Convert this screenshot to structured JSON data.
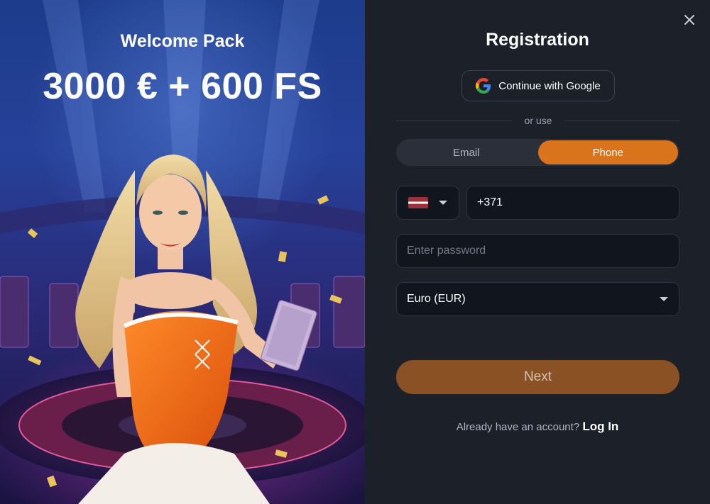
{
  "promo": {
    "title": "Welcome Pack",
    "amount": "3000 € + 600 FS"
  },
  "form": {
    "title": "Registration",
    "google_label": "Continue with Google",
    "divider_text": "or use",
    "tabs": [
      {
        "label": "Email",
        "active": false
      },
      {
        "label": "Phone",
        "active": true
      }
    ],
    "country_flag": "latvia-flag",
    "phone_value": "+371",
    "password_placeholder": "Enter password",
    "currency_value": "Euro (EUR)",
    "next_label": "Next",
    "login_prompt": "Already have an account?",
    "login_link": "Log In"
  },
  "colors": {
    "accent": "#d9741c",
    "next_disabled": "#8a5224",
    "panel_bg": "#1c2029",
    "field_bg": "#11151d"
  },
  "icons": {
    "close": "close-icon",
    "google": "google-icon",
    "dropdown": "chevron-down-icon"
  }
}
